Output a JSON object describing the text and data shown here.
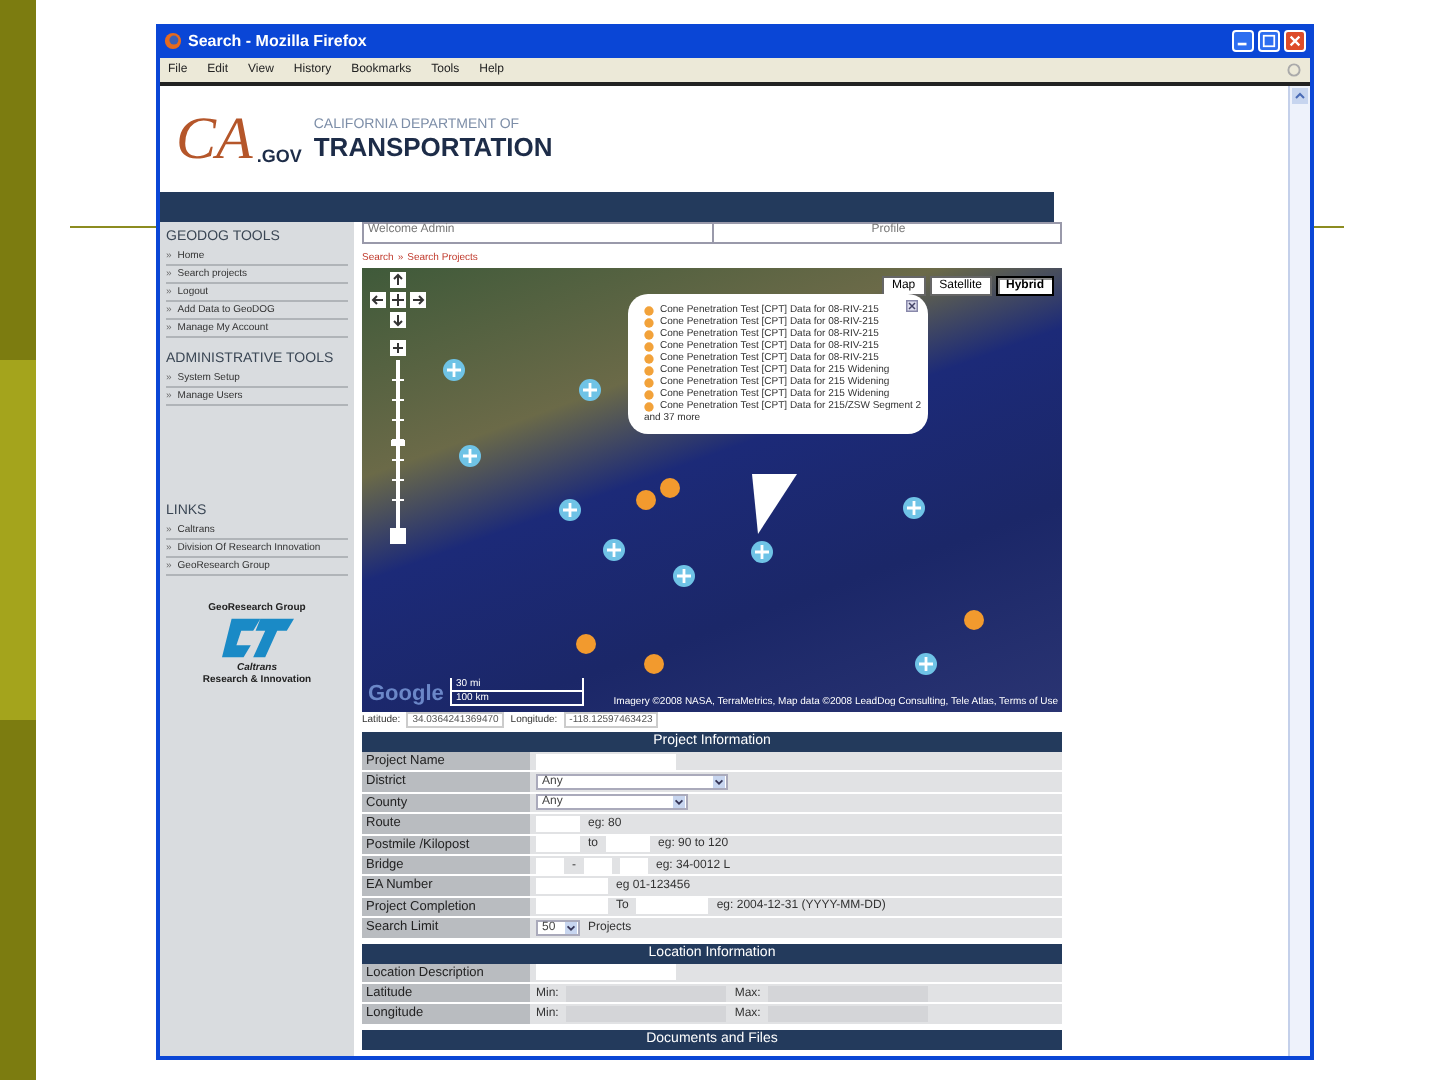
{
  "window": {
    "title": "Search - Mozilla Firefox"
  },
  "menu": [
    "File",
    "Edit",
    "View",
    "History",
    "Bookmarks",
    "Tools",
    "Help"
  ],
  "header": {
    "logo_mark": "CA",
    "logo_suffix": ".GOV",
    "department": "CALIFORNIA DEPARTMENT OF",
    "agency": "TRANSPORTATION"
  },
  "sidebar": {
    "bullet": "»",
    "sections": [
      {
        "title": "GEODOG TOOLS",
        "items": [
          "Home",
          "Search projects",
          "Logout",
          "Add Data to GeoDOG",
          "Manage My Account"
        ]
      },
      {
        "title": "ADMINISTRATIVE TOOLS",
        "items": [
          "System Setup",
          "Manage Users"
        ]
      },
      {
        "title": "LINKS",
        "items": [
          "Caltrans",
          "Division Of Research Innovation",
          "GeoResearch Group"
        ]
      }
    ]
  },
  "logo": {
    "ring_top": "GeoResearch Group",
    "brand": "Caltrans",
    "ring_bottom": "Research & Innovation"
  },
  "topbar": {
    "welcome": "Welcome Admin",
    "profile": "Profile"
  },
  "breadcrumb": {
    "items": [
      "Search",
      "Search Projects"
    ],
    "separator": "»"
  },
  "map": {
    "map_types": [
      {
        "label": "Map",
        "selected": false
      },
      {
        "label": "Satellite",
        "selected": false
      },
      {
        "label": "Hybrid",
        "selected": true
      }
    ],
    "popup": {
      "items": [
        "Cone Penetration Test [CPT] Data for 08-RIV-215",
        "Cone Penetration Test [CPT] Data for 08-RIV-215",
        "Cone Penetration Test [CPT] Data for 08-RIV-215",
        "Cone Penetration Test [CPT] Data for 08-RIV-215",
        "Cone Penetration Test [CPT] Data for 08-RIV-215",
        "Cone Penetration Test [CPT] Data for 215 Widening",
        "Cone Penetration Test [CPT] Data for 215 Widening",
        "Cone Penetration Test [CPT] Data for 215 Widening",
        "Cone Penetration Test [CPT] Data for 215/ZSW Segment 2"
      ],
      "more": "and 37 more"
    },
    "google": "Google",
    "scale": [
      "30 mi",
      "100 km"
    ],
    "credit": "Imagery ©2008 NASA, TerraMetrics, Map data ©2008 LeadDog Consulting, Tele Atlas, Terms of Use"
  },
  "coords": {
    "lat_label": "Latitude:",
    "lat": "34.0364241369470",
    "lng_label": "Longitude:",
    "lng": "-118.12597463423"
  },
  "project_info": {
    "title": "Project Information",
    "rows": [
      {
        "label": "Project Name",
        "parts": [
          {
            "kind": "input"
          }
        ]
      },
      {
        "label": "District",
        "parts": [
          {
            "kind": "select",
            "value": "Any"
          }
        ]
      },
      {
        "label": "County",
        "parts": [
          {
            "kind": "select-narrow",
            "value": "Any"
          }
        ]
      },
      {
        "label": "Route",
        "parts": [
          {
            "kind": "input-short"
          },
          {
            "kind": "text",
            "text": "eg: 80"
          }
        ]
      },
      {
        "label": "Postmile /Kilopost",
        "parts": [
          {
            "kind": "input-short"
          },
          {
            "kind": "text",
            "text": "to"
          },
          {
            "kind": "input-short"
          },
          {
            "kind": "text",
            "text": "eg: 90 to 120"
          }
        ]
      },
      {
        "label": "Bridge",
        "parts": [
          {
            "kind": "input-tiny"
          },
          {
            "kind": "text",
            "text": "-"
          },
          {
            "kind": "input-tiny"
          },
          {
            "kind": "input-tiny"
          },
          {
            "kind": "text",
            "text": "eg: 34-0012 L"
          }
        ]
      },
      {
        "label": "EA Number",
        "parts": [
          {
            "kind": "input-mid"
          },
          {
            "kind": "text",
            "text": "eg 01-123456"
          }
        ]
      },
      {
        "label": "Project Completion",
        "parts": [
          {
            "kind": "input-mid"
          },
          {
            "kind": "text",
            "text": "To"
          },
          {
            "kind": "input-mid"
          },
          {
            "kind": "text",
            "text": "eg: 2004-12-31 (YYYY-MM-DD)"
          }
        ]
      },
      {
        "label": "Search Limit",
        "parts": [
          {
            "kind": "select-tiny",
            "value": "50"
          },
          {
            "kind": "text",
            "text": "Projects"
          }
        ]
      }
    ]
  },
  "location_info": {
    "title": "Location Information",
    "rows": [
      {
        "label": "Location Description",
        "parts": [
          {
            "kind": "input"
          }
        ]
      },
      {
        "label": "Latitude",
        "parts": [
          {
            "kind": "text",
            "text": "Min:"
          },
          {
            "kind": "input-grey"
          },
          {
            "kind": "text",
            "text": "Max:"
          },
          {
            "kind": "input-grey"
          }
        ]
      },
      {
        "label": "Longitude",
        "parts": [
          {
            "kind": "text",
            "text": "Min:"
          },
          {
            "kind": "input-grey"
          },
          {
            "kind": "text",
            "text": "Max:"
          },
          {
            "kind": "input-grey"
          }
        ]
      }
    ]
  },
  "next_section": {
    "title": "Documents and Files"
  }
}
